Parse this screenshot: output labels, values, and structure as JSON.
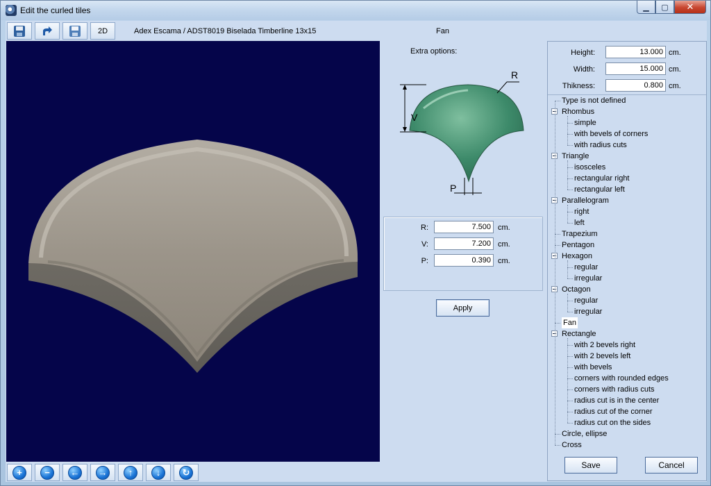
{
  "window": {
    "title": "Edit the curled tiles"
  },
  "toolbar": {
    "mode_label": "2D",
    "product_name": "Adex Escama / ADST8019 Biselada Timberline 13x15",
    "shape_name": "Fan"
  },
  "options": {
    "extra_label": "Extra options:",
    "diagram": {
      "r_label": "R",
      "v_label": "V",
      "p_label": "P",
      "tile_color": "#3d8a6a"
    },
    "fields": [
      {
        "label": "R:",
        "value": "7.500",
        "unit": "cm."
      },
      {
        "label": "V:",
        "value": "7.200",
        "unit": "cm."
      },
      {
        "label": "P:",
        "value": "0.390",
        "unit": "cm."
      }
    ],
    "apply_label": "Apply"
  },
  "dimensions": [
    {
      "label": "Height:",
      "value": "13.000",
      "unit": "cm."
    },
    {
      "label": "Width:",
      "value": "15.000",
      "unit": "cm."
    },
    {
      "label": "Thikness:",
      "value": "0.800",
      "unit": "cm."
    }
  ],
  "tree": [
    {
      "label": "Type is not defined",
      "level": 0
    },
    {
      "label": "Rhombus",
      "level": 0,
      "expanded": true
    },
    {
      "label": "simple",
      "level": 1
    },
    {
      "label": "with bevels of corners",
      "level": 1
    },
    {
      "label": "with radius cuts",
      "level": 1
    },
    {
      "label": "Triangle",
      "level": 0,
      "expanded": true
    },
    {
      "label": "isosceles",
      "level": 1
    },
    {
      "label": "rectangular right",
      "level": 1
    },
    {
      "label": "rectangular left",
      "level": 1
    },
    {
      "label": "Parallelogram",
      "level": 0,
      "expanded": true
    },
    {
      "label": "right",
      "level": 1
    },
    {
      "label": "left",
      "level": 1
    },
    {
      "label": "Trapezium",
      "level": 0
    },
    {
      "label": "Pentagon",
      "level": 0
    },
    {
      "label": "Hexagon",
      "level": 0,
      "expanded": true
    },
    {
      "label": "regular",
      "level": 1
    },
    {
      "label": "irregular",
      "level": 1
    },
    {
      "label": "Octagon",
      "level": 0,
      "expanded": true
    },
    {
      "label": "regular",
      "level": 1
    },
    {
      "label": "irregular",
      "level": 1
    },
    {
      "label": "Fan",
      "level": 0,
      "selected": true
    },
    {
      "label": "Rectangle",
      "level": 0,
      "expanded": true
    },
    {
      "label": "with 2 bevels right",
      "level": 1
    },
    {
      "label": "with 2 bevels left",
      "level": 1
    },
    {
      "label": "with bevels",
      "level": 1
    },
    {
      "label": "corners with rounded edges",
      "level": 1
    },
    {
      "label": "corners with radius cuts",
      "level": 1
    },
    {
      "label": "radius cut is in the center",
      "level": 1
    },
    {
      "label": "radius cut of the corner",
      "level": 1
    },
    {
      "label": "radius cut on the sides",
      "level": 1
    },
    {
      "label": "Circle, ellipse",
      "level": 0
    },
    {
      "label": "Cross",
      "level": 0
    }
  ],
  "footer": {
    "save_label": "Save",
    "cancel_label": "Cancel"
  },
  "colors": {
    "viewport_bg": "#05054a",
    "tile_color": "#9c958a"
  }
}
